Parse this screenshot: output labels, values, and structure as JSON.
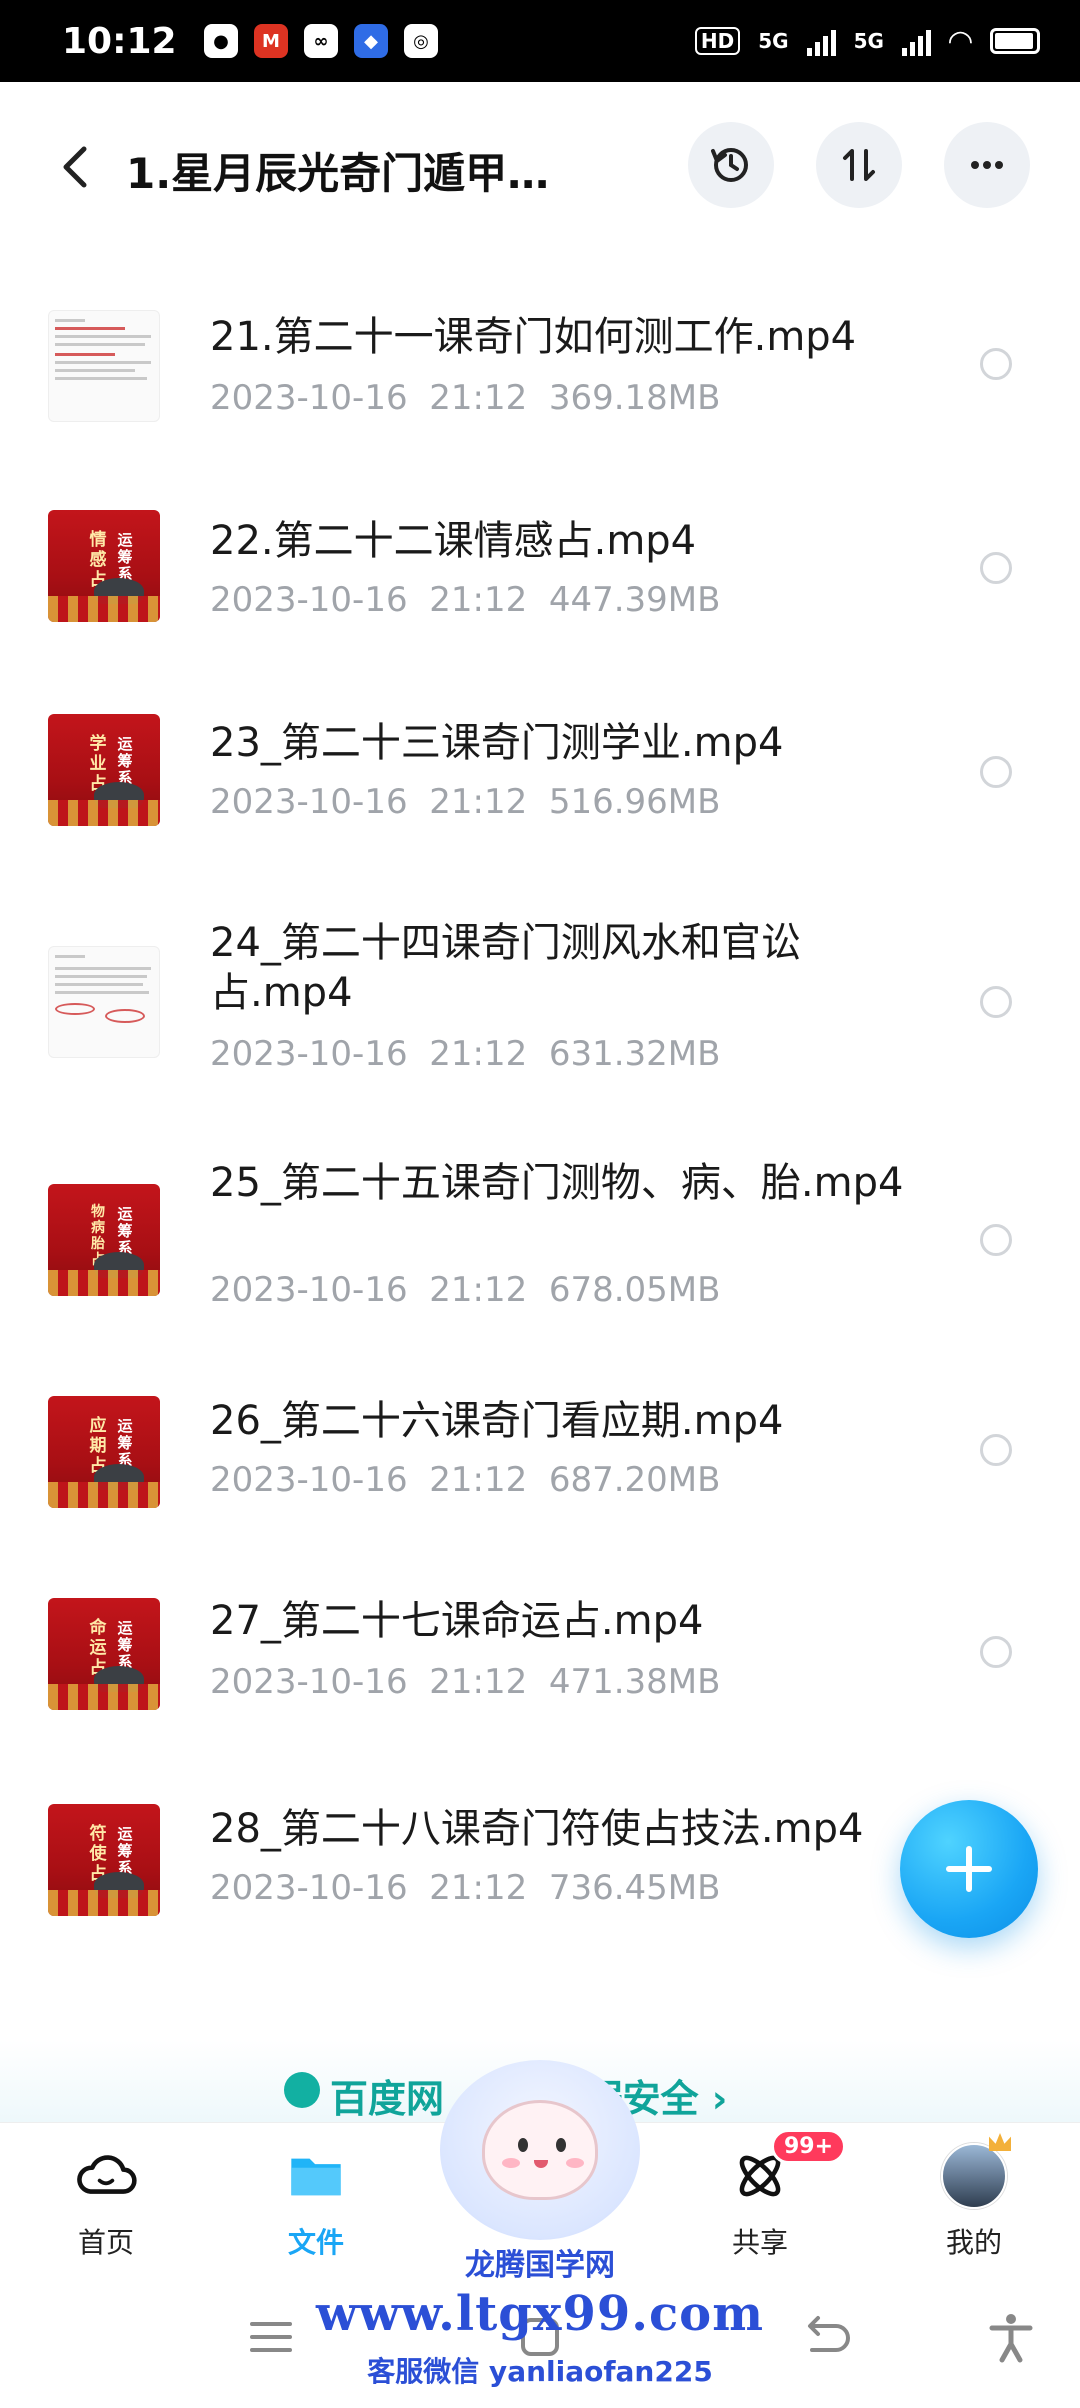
{
  "status_bar": {
    "time": "10:12",
    "left_icons": [
      "chat-icon",
      "bank-app-icon",
      "cloud-drive-icon",
      "baidu-icon",
      "browser-icon"
    ],
    "hd_label": "HD",
    "network_1": "5G",
    "network_2": "5G"
  },
  "header": {
    "title": "1.星月辰光奇门遁甲…",
    "icons": [
      "back-arrow-icon",
      "history-icon",
      "sort-icon",
      "more-icon"
    ]
  },
  "files": [
    {
      "name": "21.第二十一课奇门如何测工作.mp4",
      "date": "2023-10-16",
      "time": "21:12",
      "size": "369.18MB",
      "thumb": "doc"
    },
    {
      "name": "22.第二十二课情感占.mp4",
      "date": "2023-10-16",
      "time": "21:12",
      "size": "447.39MB",
      "thumb": "red",
      "thumb_side": "情感占",
      "thumb_main": "运筹系统"
    },
    {
      "name": "23_第二十三课奇门测学业.mp4",
      "date": "2023-10-16",
      "time": "21:12",
      "size": "516.96MB",
      "thumb": "red",
      "thumb_side": "学业占",
      "thumb_main": "运筹系统"
    },
    {
      "name": "24_第二十四课奇门测风水和官讼占.mp4",
      "date": "2023-10-16",
      "time": "21:12",
      "size": "631.32MB",
      "thumb": "doc"
    },
    {
      "name": "25_第二十五课奇门测物、病、胎.mp4",
      "date": "2023-10-16",
      "time": "21:12",
      "size": "678.05MB",
      "thumb": "red",
      "thumb_side": "物病胎占",
      "thumb_main": "运筹系统"
    },
    {
      "name": "26_第二十六课奇门看应期.mp4",
      "date": "2023-10-16",
      "time": "21:12",
      "size": "687.20MB",
      "thumb": "red",
      "thumb_side": "应期占",
      "thumb_main": "运筹系统"
    },
    {
      "name": "27_第二十七课命运占.mp4",
      "date": "2023-10-16",
      "time": "21:12",
      "size": "471.38MB",
      "thumb": "red",
      "thumb_side": "命运占",
      "thumb_main": "运筹系统"
    },
    {
      "name": "28_第二十八课奇门符使占技法.mp4",
      "date": "2023-10-16",
      "time": "21:12",
      "size": "736.45MB",
      "thumb": "red",
      "thumb_side": "符使占",
      "thumb_main": "运筹系统"
    }
  ],
  "peek_banner": {
    "text": "百度网 …… 数据安全 ›"
  },
  "tabbar": {
    "tabs": [
      {
        "label": "首页",
        "icon": "home-cloud-icon"
      },
      {
        "label": "文件",
        "icon": "folder-icon",
        "active": true
      },
      {
        "label": "",
        "icon": "mascot-icon"
      },
      {
        "label": "共享",
        "icon": "share-atom-icon",
        "badge": "99+"
      },
      {
        "label": "我的",
        "icon": "avatar-icon"
      }
    ]
  },
  "watermark": {
    "site_name": "龙腾国学网",
    "url": "www.ltgx99.com",
    "contact": "客服微信 yanliaofan225"
  },
  "navbar": {
    "icons": [
      "menu-icon",
      "home-square-icon",
      "back-icon",
      "accessibility-icon"
    ]
  },
  "colors": {
    "accent": "#1aa6f5",
    "badge": "#ff3a5c",
    "meta_gray": "#a0a4aa",
    "watermark_blue": "#2b4fd6"
  }
}
